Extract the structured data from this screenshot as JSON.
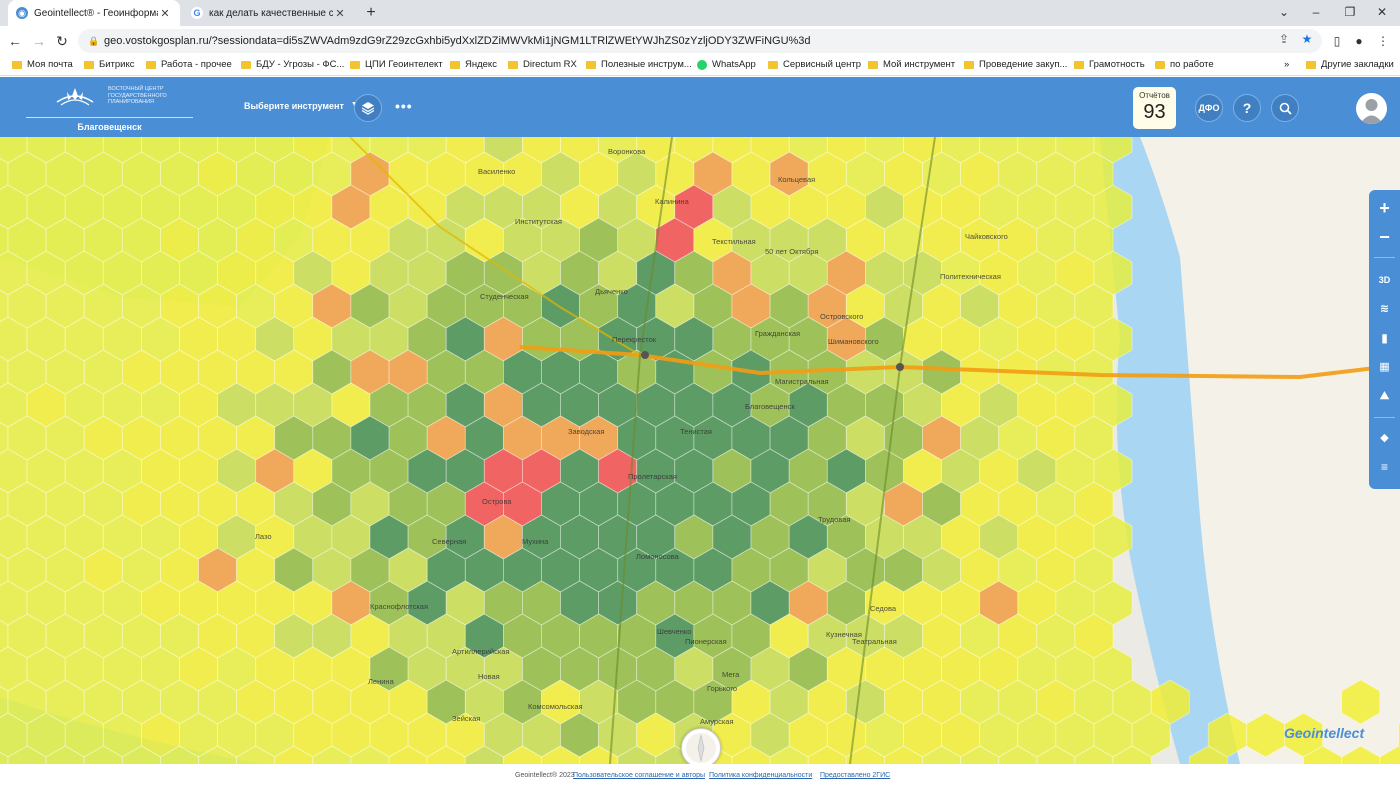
{
  "browser": {
    "tabs": [
      {
        "title": "Geointellect® - Геоинформаци",
        "active": true
      },
      {
        "title": "как делать качественные снимк",
        "active": false
      }
    ],
    "url": "geo.vostokgosplan.ru/?sessiondata=di5sZWVAdm9zdG9rZ29zcGxhbi5ydXxlZDZiMWVkMi1jNGM1LTRlZWEtYWJhZS0zYzljODY3ZWFiNGU%3d",
    "bookmarks": [
      "Моя почта",
      "Битрикс",
      "Работа - прочее",
      "БДУ - Угрозы - ФС...",
      "ЦПИ Геоинтелект",
      "Яндекс",
      "Directum RX",
      "Полезные инструм...",
      "WhatsApp",
      "Сервисный центр",
      "Мой инструмент",
      "Проведение закуп...",
      "Грамотность",
      "по работе"
    ],
    "bookmarks_other": "Другие закладки"
  },
  "header": {
    "logo_text": "ВОСТОЧНЫЙ ЦЕНТР ГОСУДАРСТВЕННОГО ПЛАНИРОВАНИЯ",
    "city": "Благовещенск",
    "tool_select": "Выберите инструмент",
    "district_button": "ДФО",
    "help_button": "?",
    "reports_label": "Отчётов",
    "reports_count": "93"
  },
  "map": {
    "street_labels": [
      "Воронкова",
      "Калинина",
      "Институтская",
      "Василенко",
      "Текстильная",
      "Кольцевая",
      "Студенческая",
      "Дьяченко",
      "50 лет Октября",
      "Островского",
      "Политехническая",
      "Шимановского",
      "Чайковского",
      "Гражданская",
      "Перекресток",
      "Магистральная",
      "Благовещенск",
      "Тенистая",
      "Заводская",
      "Мухина",
      "Острова",
      "Северная",
      "Пролетарская",
      "Ломоносова",
      "Краснофлотская",
      "Артиллерийская",
      "Новая",
      "Комсомольская",
      "Зейская",
      "Амурская",
      "Горького",
      "Мега",
      "Пионерская",
      "Шевченко",
      "Трудовая",
      "Кузнечная",
      "Театральная",
      "Лазо",
      "Ленина",
      "Седова"
    ],
    "compass_icon": "compass-icon",
    "watermark": "Geointellect"
  },
  "map_tools": {
    "zoom_in": "+",
    "zoom_out": "−",
    "mode_3d": "3D"
  },
  "footer": {
    "copyright": "Geointellect® 2023",
    "agreement": "Пользовательское соглашение и авторы",
    "privacy": "Политика конфиденциальности",
    "provider": "Предоставлено 2ГИС"
  },
  "colors": {
    "header": "#4a8fd6",
    "hex_dark_green": "#3e8b4a",
    "hex_mid_green": "#8db83a",
    "hex_light_green": "#c5dc48",
    "hex_yellow": "#f2ee2e",
    "hex_orange": "#f09a3c",
    "hex_red": "#f04848"
  }
}
